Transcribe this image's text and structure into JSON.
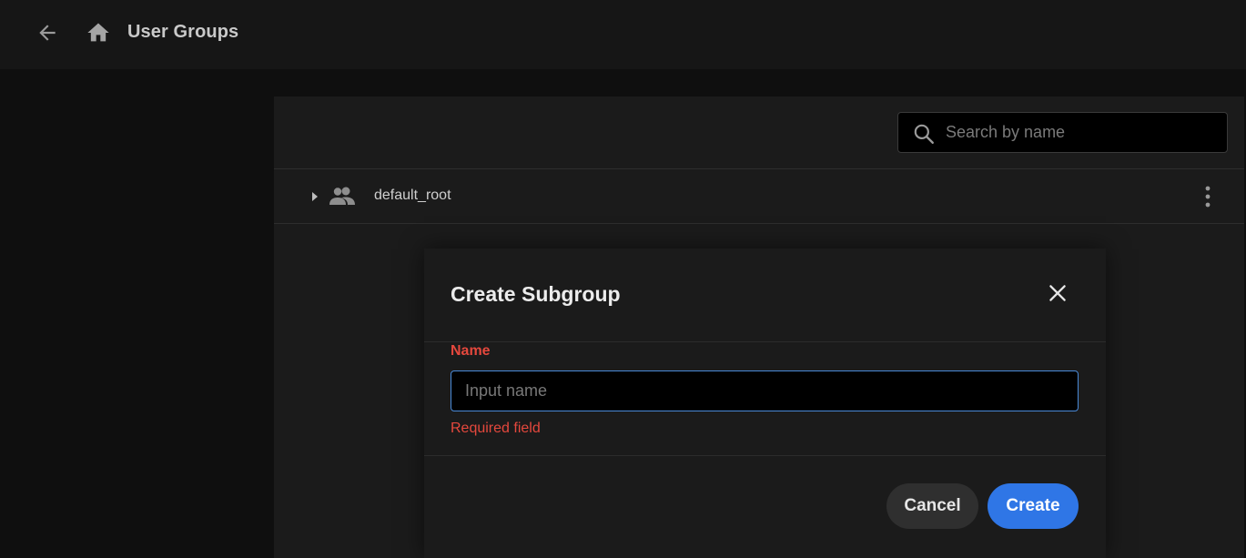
{
  "header": {
    "title": "User Groups",
    "back_icon": "arrow-left-icon",
    "home_icon": "home-icon"
  },
  "search": {
    "placeholder": "Search by name",
    "value": "",
    "icon": "search-icon"
  },
  "groups": [
    {
      "name": "default_root",
      "expanded": false,
      "icon": "people-icon"
    }
  ],
  "modal": {
    "title": "Create Subgroup",
    "name_label": "Name",
    "name_placeholder": "Input name",
    "name_value": "",
    "error_text": "Required field",
    "cancel_label": "Cancel",
    "create_label": "Create"
  },
  "colors": {
    "background": "#0f0f0f",
    "topbar": "#161616",
    "panel": "#1b1b1b",
    "accent": "#2f76e6",
    "error": "#e5483d",
    "input_focus_border": "#4a8ad8"
  }
}
